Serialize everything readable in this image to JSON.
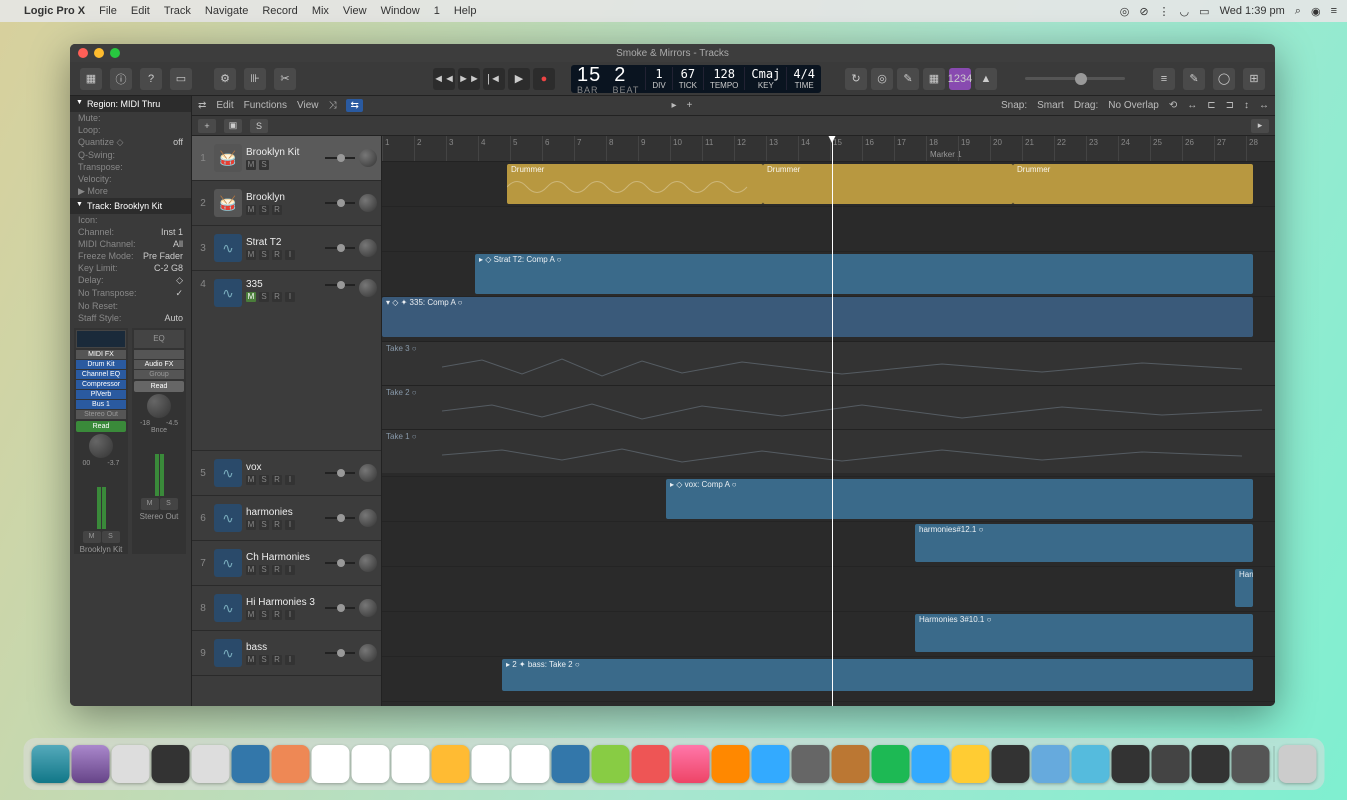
{
  "menubar": {
    "app": "Logic Pro X",
    "items": [
      "File",
      "Edit",
      "Track",
      "Navigate",
      "Record",
      "Mix",
      "View",
      "Window",
      "1",
      "Help"
    ],
    "clock": "Wed 1:39 pm"
  },
  "window_title": "Smoke & Mirrors - Tracks",
  "lcd": {
    "bar": "15",
    "beat": "2",
    "div": "1",
    "tick": "67",
    "tempo": "128",
    "key": "Cmaj",
    "sig": "4/4",
    "labels": {
      "bar": "BAR",
      "beat": "BEAT",
      "div": "DIV",
      "tick": "TICK",
      "tempo": "TEMPO",
      "key": "KEY",
      "sig": "TIME"
    }
  },
  "track_menu": {
    "edit": "Edit",
    "functions": "Functions",
    "view": "View",
    "snap_label": "Snap:",
    "snap_value": "Smart",
    "drag_label": "Drag:",
    "drag_value": "No Overlap"
  },
  "inspector": {
    "region_header": "Region: MIDI Thru",
    "rows1": [
      {
        "lbl": "Mute:",
        "val": ""
      },
      {
        "lbl": "Loop:",
        "val": ""
      },
      {
        "lbl": "Quantize ◇",
        "val": "off"
      },
      {
        "lbl": "Q-Swing:",
        "val": ""
      },
      {
        "lbl": "Transpose:",
        "val": ""
      },
      {
        "lbl": "Velocity:",
        "val": ""
      },
      {
        "lbl": "▶ More",
        "val": ""
      }
    ],
    "track_header": "Track: Brooklyn Kit",
    "rows2": [
      {
        "lbl": "Icon:",
        "val": ""
      },
      {
        "lbl": "Channel:",
        "val": "Inst 1"
      },
      {
        "lbl": "MIDI Channel:",
        "val": "All"
      },
      {
        "lbl": "Freeze Mode:",
        "val": "Pre Fader"
      },
      {
        "lbl": "Key Limit:",
        "val": "C-2  G8"
      },
      {
        "lbl": "Delay:",
        "val": "◇"
      },
      {
        "lbl": "No Transpose:",
        "val": "✓"
      },
      {
        "lbl": "No Reset:",
        "val": ""
      },
      {
        "lbl": "Staff Style:",
        "val": "Auto"
      }
    ],
    "strip1": {
      "name": "Brooklyn Kit",
      "midi_fx": "MIDI FX",
      "inst": "Drum Kit",
      "plugins": [
        "Channel EQ",
        "Compressor",
        "PlVerb"
      ],
      "sends": [
        "Bus 1"
      ],
      "output": "Stereo Out",
      "auto": "Read",
      "db_l": "00",
      "db_r": "-3.7"
    },
    "strip2": {
      "name": "Stereo Out",
      "eq": "EQ",
      "audiofx": "Audio FX",
      "group": "Group",
      "bounce": "Bnce",
      "auto": "Read",
      "db_l": "-18",
      "db_r": "-4.5"
    }
  },
  "tracks": [
    {
      "num": "1",
      "name": "Brooklyn Kit",
      "ctrls": [
        "M",
        "S"
      ],
      "sel": true,
      "type": "drum"
    },
    {
      "num": "2",
      "name": "Brooklyn",
      "ctrls": [
        "M",
        "S",
        "R"
      ],
      "type": "drum"
    },
    {
      "num": "3",
      "name": "Strat T2",
      "ctrls": [
        "M",
        "S",
        "R",
        "I"
      ],
      "type": "audio"
    },
    {
      "num": "4",
      "name": "335",
      "ctrls": [
        "M",
        "S",
        "R",
        "I"
      ],
      "type": "audio",
      "expanded": true,
      "mute": true
    },
    {
      "num": "5",
      "name": "vox",
      "ctrls": [
        "M",
        "S",
        "R",
        "I"
      ],
      "type": "audio"
    },
    {
      "num": "6",
      "name": "harmonies",
      "ctrls": [
        "M",
        "S",
        "R",
        "I"
      ],
      "type": "audio"
    },
    {
      "num": "7",
      "name": "Ch Harmonies",
      "ctrls": [
        "M",
        "S",
        "R",
        "I"
      ],
      "type": "audio"
    },
    {
      "num": "8",
      "name": "Hi Harmonies 3",
      "ctrls": [
        "M",
        "S",
        "R",
        "I"
      ],
      "type": "audio"
    },
    {
      "num": "9",
      "name": "bass",
      "ctrls": [
        "M",
        "S",
        "R",
        "I"
      ],
      "type": "audio"
    }
  ],
  "ruler_bars": [
    1,
    2,
    3,
    4,
    5,
    6,
    7,
    8,
    9,
    10,
    11,
    12,
    13,
    14,
    15,
    16,
    17,
    18,
    19,
    20,
    21,
    22,
    23,
    24,
    25,
    26,
    27,
    28
  ],
  "markers": {
    "marker1": "Marker 1"
  },
  "regions": {
    "drummer": "Drummer",
    "strat": "Strat T2: Comp A",
    "comp335": "335: Comp A",
    "take3": "Take 3",
    "take2": "Take 2",
    "take1": "Take 1",
    "vox": "vox: Comp A",
    "harm": "harmonies#12.1",
    "chharm": "Harm",
    "hiharm": "Harmonies 3#10.1",
    "bass": "bass: Take 2"
  },
  "playhead_bar": 15
}
